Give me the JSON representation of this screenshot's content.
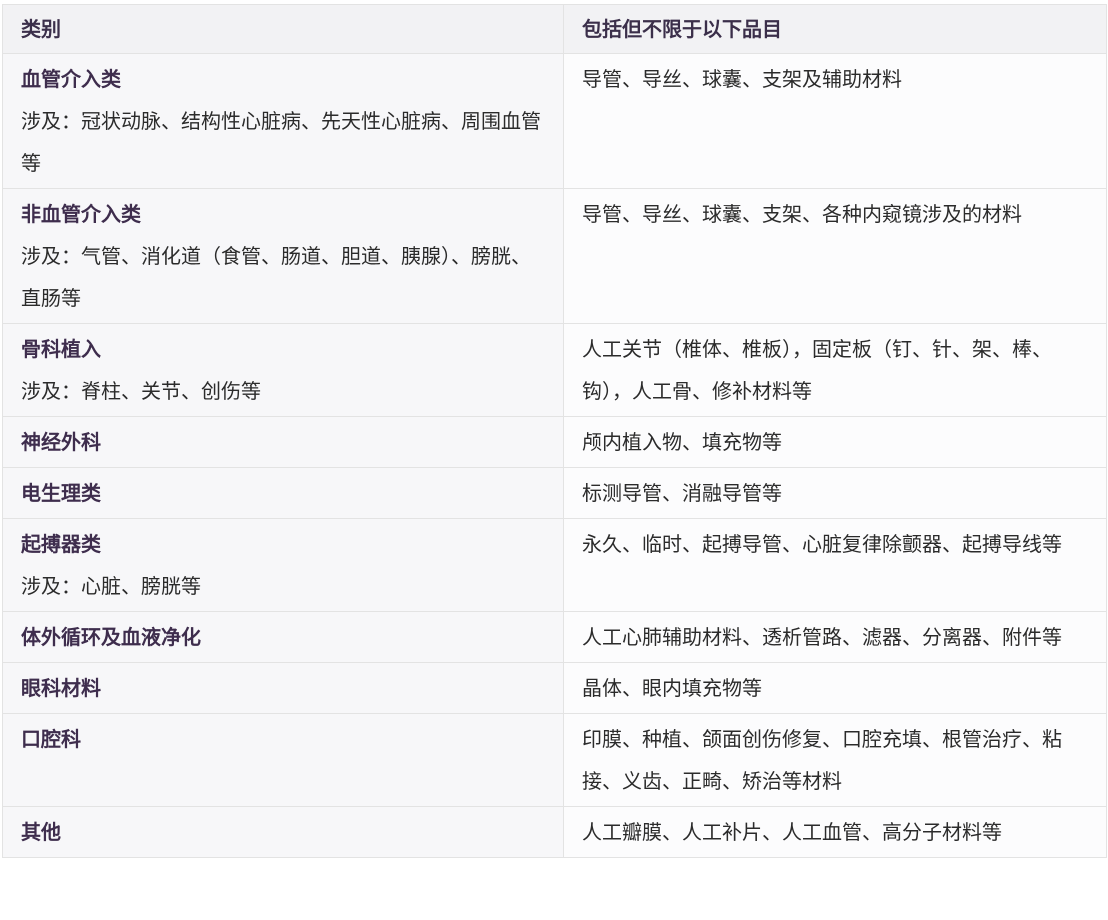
{
  "table": {
    "headers": [
      "类别",
      "包括但不限于以下品目"
    ],
    "rows": [
      {
        "title": "血管介入类",
        "sub": "涉及：冠状动脉、结构性心脏病、先天性心脏病、周围血管等",
        "items": "导管、导丝、球囊、支架及辅助材料"
      },
      {
        "title": "非血管介入类",
        "sub": "涉及：气管、消化道（食管、肠道、胆道、胰腺）、膀胱、直肠等",
        "items": "导管、导丝、球囊、支架、各种内窥镜涉及的材料"
      },
      {
        "title": "骨科植入",
        "sub": "涉及：脊柱、关节、创伤等",
        "items": "人工关节（椎体、椎板），固定板（钉、针、架、棒、钩），人工骨、修补材料等"
      },
      {
        "title": "神经外科",
        "sub": "",
        "items": "颅内植入物、填充物等"
      },
      {
        "title": "电生理类",
        "sub": "",
        "items": "标测导管、消融导管等"
      },
      {
        "title": "起搏器类",
        "sub": "涉及：心脏、膀胱等",
        "items": "永久、临时、起搏导管、心脏复律除颤器、起搏导线等"
      },
      {
        "title": "体外循环及血液净化",
        "sub": "",
        "items": "人工心肺辅助材料、透析管路、滤器、分离器、附件等"
      },
      {
        "title": "眼科材料",
        "sub": "",
        "items": "晶体、眼内填充物等"
      },
      {
        "title": "口腔科",
        "sub": "",
        "items": "印膜、种植、颌面创伤修复、口腔充填、根管治疗、粘接、义齿、正畸、矫治等材料"
      },
      {
        "title": "其他",
        "sub": "",
        "items": "人工瓣膜、人工补片、人工血管、高分子材料等"
      }
    ]
  }
}
